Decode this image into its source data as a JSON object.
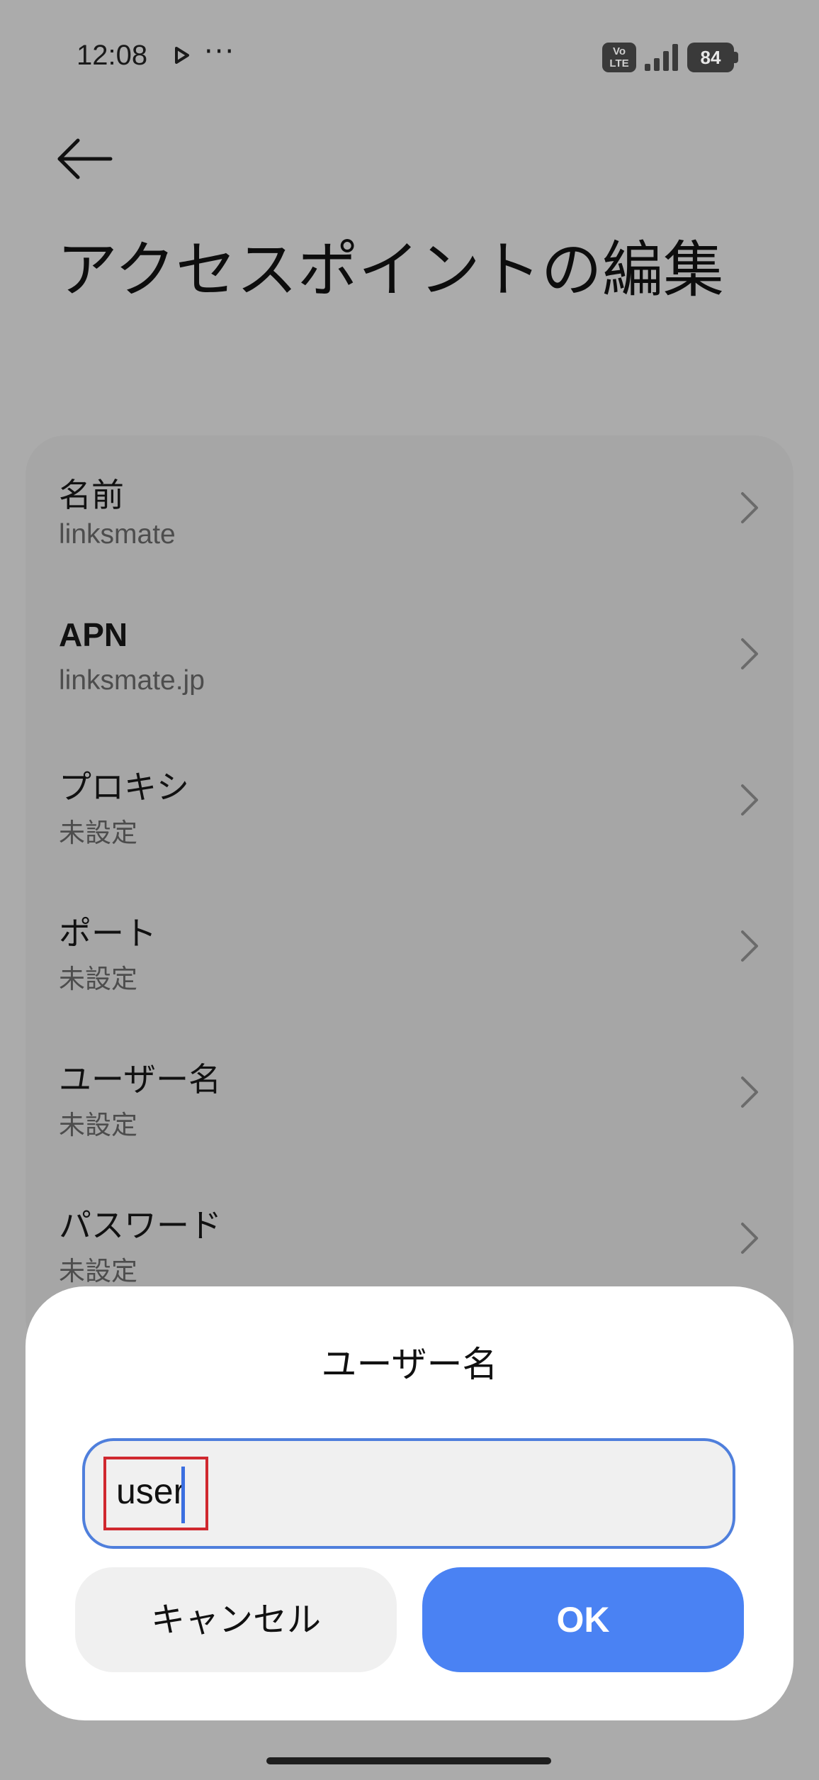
{
  "status_bar": {
    "time": "12:08",
    "overflow_indicator": "···",
    "volte_top": "Vo",
    "volte_bottom": "LTE",
    "battery_level": "84",
    "icons": [
      "play-icon",
      "volte-icon",
      "signal-icon",
      "battery-icon"
    ]
  },
  "header": {
    "back_icon": "back-arrow-icon",
    "title": "アクセスポイントの編集"
  },
  "settings": {
    "items": [
      {
        "label": "名前",
        "value": "linksmate"
      },
      {
        "label": "APN",
        "value": "linksmate.jp"
      },
      {
        "label": "プロキシ",
        "value": "未設定"
      },
      {
        "label": "ポート",
        "value": "未設定"
      },
      {
        "label": "ユーザー名",
        "value": "未設定"
      },
      {
        "label": "パスワード",
        "value": "未設定"
      }
    ]
  },
  "dialog": {
    "title": "ユーザー名",
    "input_value": "user",
    "cancel_label": "キャンセル",
    "ok_label": "OK"
  },
  "colors": {
    "scrim_background": "#ababab",
    "card_background": "#a6a6a6",
    "accent": "#4a82f3",
    "input_border": "#4f7fdc",
    "highlight_box": "#d0282f"
  }
}
